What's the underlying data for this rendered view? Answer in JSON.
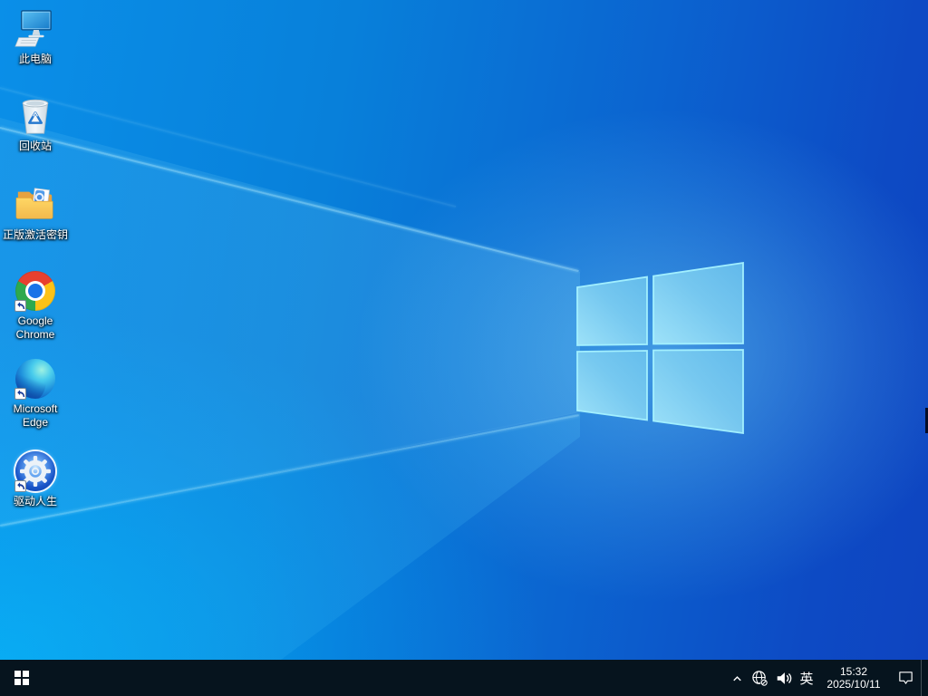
{
  "desktop": {
    "icons": [
      {
        "label": "此电脑",
        "icon": "this-pc-icon",
        "shortcut": false
      },
      {
        "label": "回收站",
        "icon": "recycle-bin-icon",
        "shortcut": false
      },
      {
        "label": "正版激活密钥",
        "icon": "activation-key-folder-icon",
        "shortcut": false
      },
      {
        "label": "Google Chrome",
        "icon": "chrome-icon",
        "shortcut": true
      },
      {
        "label": "Microsoft Edge",
        "icon": "edge-icon",
        "shortcut": true
      },
      {
        "label": "驱动人生",
        "icon": "driver-genius-gear-icon",
        "shortcut": true
      }
    ]
  },
  "taskbar": {
    "start_icon": "windows-start-icon",
    "tray": {
      "icons": [
        "chevron-up-icon",
        "network-globe-offline-icon",
        "speaker-icon",
        "action-center-icon"
      ],
      "ime": "英",
      "time": "15:32",
      "date": "2025/10/11"
    }
  },
  "wallpaper": {
    "logo": "windows-light-logo",
    "colors": {
      "bright_cyan": "#00a6f0",
      "azure": "#0a8fe8",
      "royal_blue": "#0d47c2",
      "logo_pane": "#7fd4f0",
      "logo_edge": "#a5f2ff",
      "taskbar_bg": "#06141e"
    }
  }
}
